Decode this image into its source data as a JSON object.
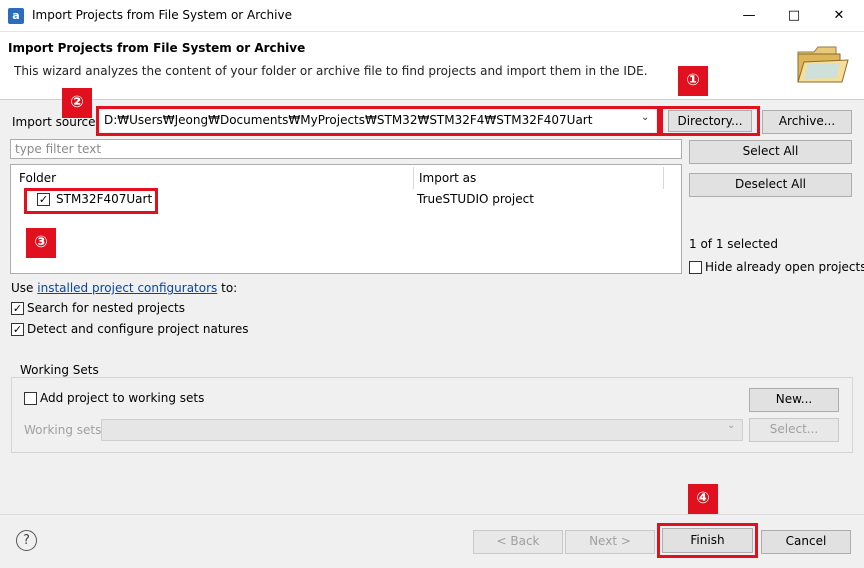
{
  "window": {
    "title": "Import Projects from File System or Archive",
    "app_icon_letter": "a"
  },
  "header": {
    "title": "Import Projects from File System or Archive",
    "description": "This wizard analyzes the content of your folder or archive file to find projects and import them in the IDE."
  },
  "import_source": {
    "label": "Import source:",
    "value": "D:₩Users₩Jeong₩Documents₩MyProjects₩STM32₩STM32F4₩STM32F407Uart",
    "directory_button": "Directory...",
    "archive_button": "Archive..."
  },
  "filter": {
    "placeholder": "type filter text"
  },
  "table": {
    "columns": [
      "Folder",
      "Import as"
    ],
    "rows": [
      {
        "folder": "STM32F407Uart",
        "import_as": "TrueSTUDIO project",
        "checked": true
      }
    ]
  },
  "side": {
    "select_all": "Select All",
    "deselect_all": "Deselect All",
    "selected_count": "1 of 1 selected",
    "hide_open": "Hide already open projects"
  },
  "options": {
    "use_prefix": "Use",
    "configurators_link": "installed project configurators",
    "use_suffix": "to:",
    "search_nested": "Search for nested projects",
    "detect_natures": "Detect and configure project natures"
  },
  "working_sets": {
    "group_label": "Working Sets",
    "add_label": "Add project to working sets",
    "sets_label": "Working sets:",
    "new_button": "New...",
    "select_button": "Select..."
  },
  "footer": {
    "help_icon": "?",
    "back_button": "< Back",
    "next_button": "Next >",
    "finish_button": "Finish",
    "cancel_button": "Cancel"
  },
  "annotations": [
    "①",
    "②",
    "③",
    "④"
  ],
  "colors": {
    "highlight": "#e0101e",
    "link": "#0645ad"
  }
}
